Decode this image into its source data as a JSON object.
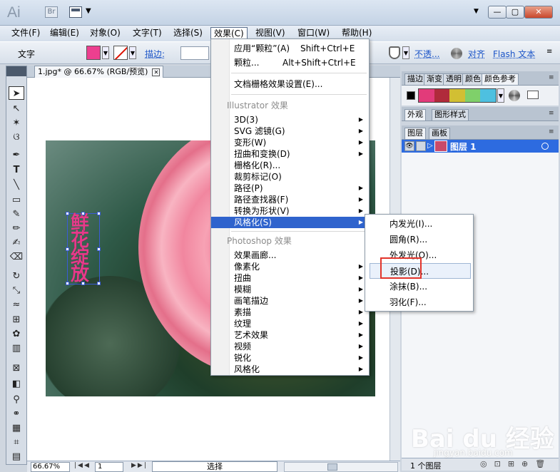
{
  "app": {
    "logo": "Ai",
    "bridge": "Br"
  },
  "menubar": [
    "文件(F)",
    "编辑(E)",
    "对象(O)",
    "文字(T)",
    "选择(S)",
    "效果(C)",
    "视图(V)",
    "窗口(W)",
    "帮助(H)"
  ],
  "control": {
    "label": "文字",
    "stroke_label": "描边:",
    "opacity_label": "不透...",
    "align_label": "对齐",
    "flash_label": "Flash 文本",
    "fill_color": "#ec3f8f"
  },
  "document": {
    "tab_title": "1.jpg* @ 66.67% (RGB/预览)"
  },
  "status": {
    "zoom": "66.67%",
    "page": "1",
    "text": "选择"
  },
  "effect_menu": {
    "items_top": [
      {
        "label": "应用“颗粒”(A)",
        "shortcut": "Shift+Ctrl+E"
      },
      {
        "label": "颗粒...",
        "shortcut": "Alt+Shift+Ctrl+E"
      }
    ],
    "doc_raster": "文档栅格效果设置(E)...",
    "illustrator_header": "Illustrator 效果",
    "illustrator_items": [
      "3D(3)",
      "SVG 滤镜(G)",
      "变形(W)",
      "扭曲和变换(D)",
      "栅格化(R)...",
      "裁剪标记(O)",
      "路径(P)",
      "路径查找器(F)",
      "转换为形状(V)",
      "风格化(S)"
    ],
    "photoshop_header": "Photoshop 效果",
    "photoshop_items": [
      "效果画廊...",
      "像素化",
      "扭曲",
      "模糊",
      "画笔描边",
      "素描",
      "纹理",
      "艺术效果",
      "视频",
      "锐化",
      "风格化"
    ]
  },
  "stylize_submenu": [
    "内发光(I)...",
    "圆角(R)...",
    "外发光(O)...",
    "投影(D)...",
    "涂抹(B)...",
    "羽化(F)..."
  ],
  "panels": {
    "tabs1": [
      "描边",
      "渐变",
      "透明",
      "颜色",
      "颜色参考"
    ],
    "tabs2": [
      "外观",
      "图形样式"
    ],
    "tabs3": [
      "图层",
      "画板"
    ],
    "layer_name": "图层 1",
    "layer_count": "1 个图层",
    "guide_colors": [
      "#e23b7a",
      "#b02b3b",
      "#d2bf33",
      "#7fd06a",
      "#4ec0e0"
    ]
  },
  "artwork_glyphs": [
    "鲜",
    "花",
    "绽",
    "放"
  ],
  "watermark": {
    "brand": "Bai du 经验",
    "url": "jingyan.baidu.com"
  }
}
